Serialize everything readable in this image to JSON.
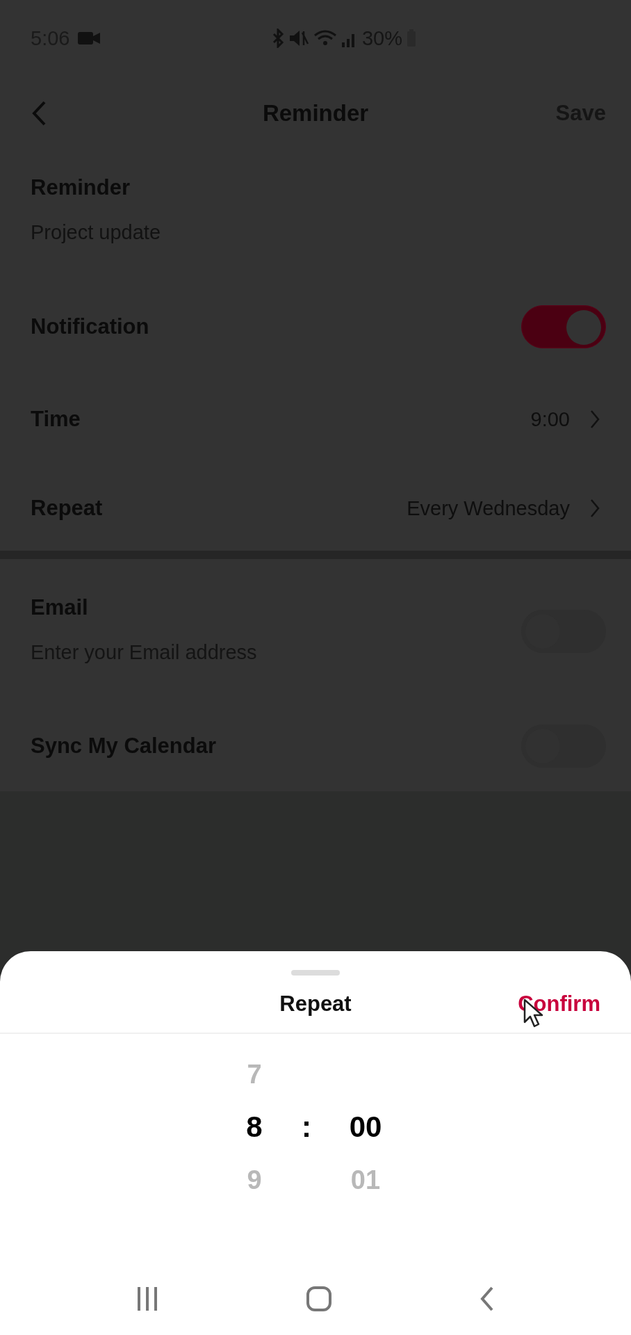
{
  "status_bar": {
    "time": "5:06",
    "battery": "30%"
  },
  "header": {
    "title": "Reminder",
    "action": "Save"
  },
  "form": {
    "reminder": {
      "label": "Reminder",
      "value": "Project update"
    },
    "notification": {
      "label": "Notification",
      "on": true
    },
    "time": {
      "label": "Time",
      "value": "9:00"
    },
    "repeat": {
      "label": "Repeat",
      "value": "Every Wednesday"
    },
    "email": {
      "label": "Email",
      "placeholder": "Enter your Email address",
      "on": false
    },
    "sync": {
      "label": "Sync My Calendar",
      "on": false
    }
  },
  "sheet": {
    "title": "Repeat",
    "confirm": "Confirm",
    "picker": {
      "separator": ":",
      "hours": [
        {
          "text": "7",
          "selected": false
        },
        {
          "text": "8",
          "selected": true
        },
        {
          "text": "9",
          "selected": false
        }
      ],
      "minutes": [
        {
          "text": "00",
          "selected": true
        },
        {
          "text": "01",
          "selected": false
        }
      ]
    }
  }
}
